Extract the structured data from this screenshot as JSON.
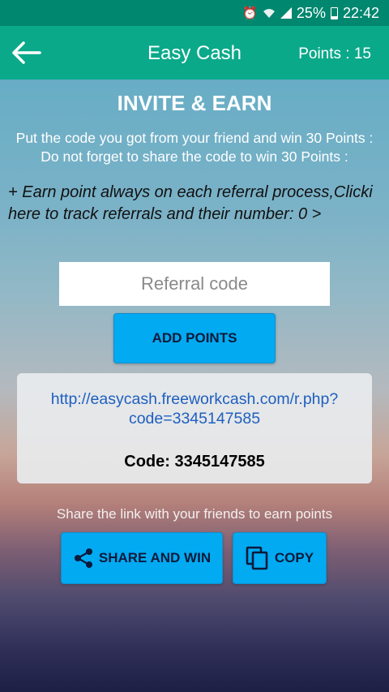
{
  "status_bar": {
    "battery_percent": "25%",
    "time": "22:42",
    "icons": [
      "alarm-icon",
      "wifi-icon",
      "signal-icon",
      "battery-icon"
    ]
  },
  "app_bar": {
    "title": "Easy Cash",
    "points_label": "Points : 15",
    "back_icon": "arrow-left-icon"
  },
  "main": {
    "heading": "INVITE & EARN",
    "line1": "Put the code you got from your friend and win 30 Points :",
    "line2": "Do not forget to share the code to win 30 Points :",
    "info": "+ Earn point always on each referral process,Clicki here to track referrals and their number:  0 >"
  },
  "referral": {
    "placeholder": "Referral code",
    "value": ""
  },
  "add_button": {
    "label": "ADD POINTS"
  },
  "link_card": {
    "link_line1": "http://easycash.freeworkcash.com/r.php?",
    "link_line2": "code=3345147585",
    "code_text": "Code: 3345147585"
  },
  "share": {
    "text": "Share the link with your friends to earn points",
    "share_label": "SHARE AND WIN",
    "copy_label": "COPY"
  },
  "colors": {
    "status_bar": "#00876f",
    "app_bar": "#0aa98a",
    "button": "#02aaf2",
    "link": "#1f5fbf"
  }
}
